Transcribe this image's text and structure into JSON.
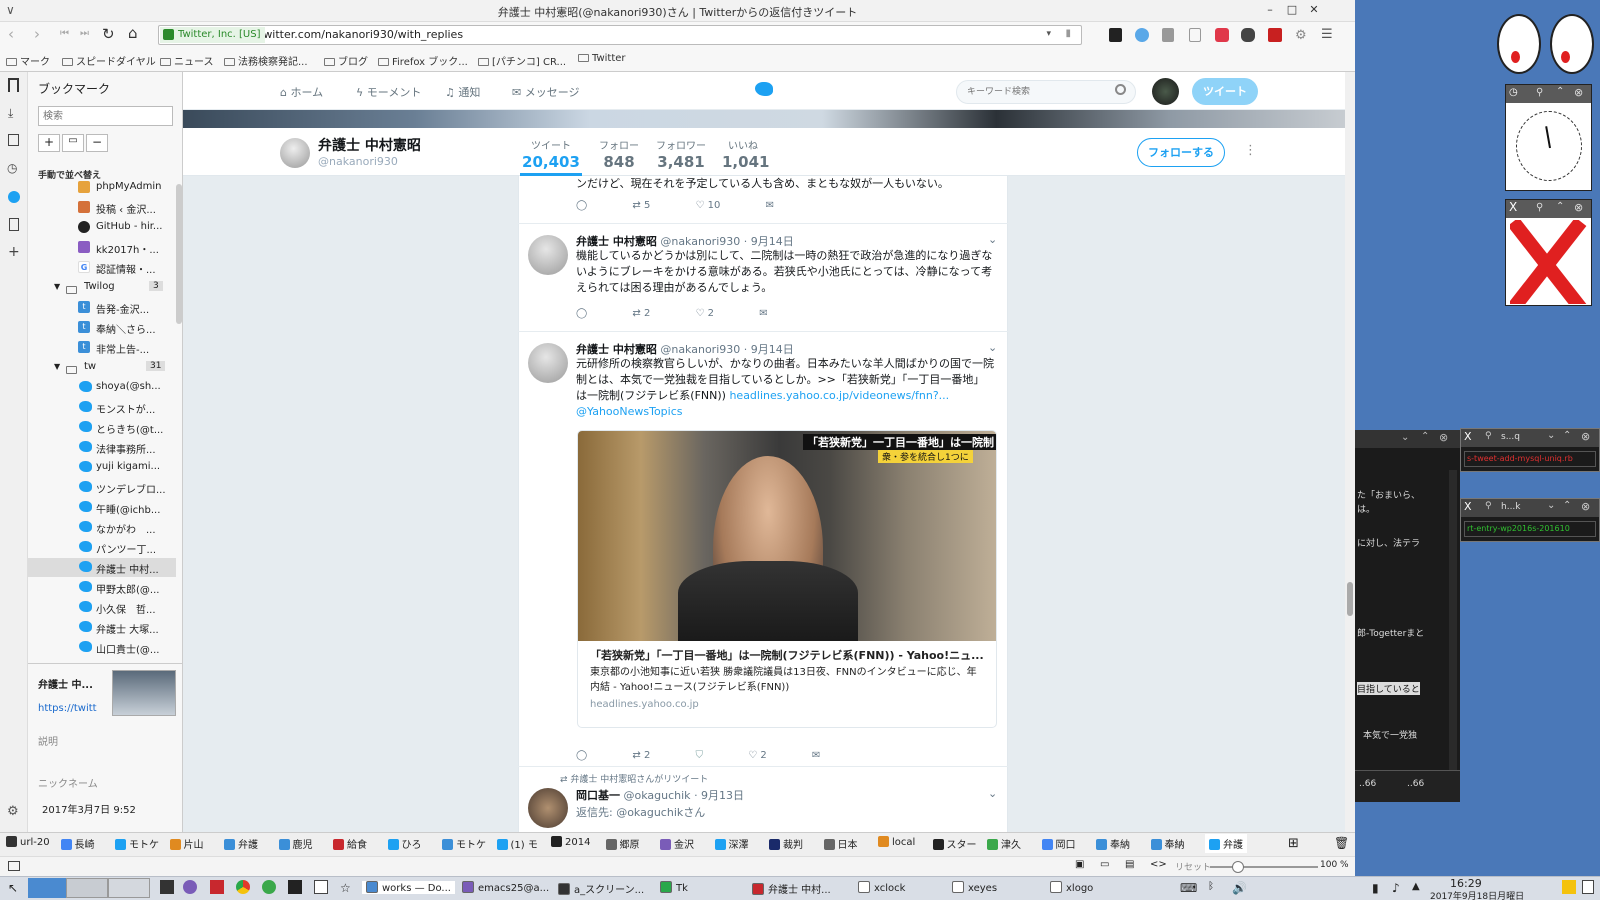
{
  "browser": {
    "window_title": "弁護士 中村憲昭(@nakanori930)さん | Twitterからの返信付きツイート",
    "secure_label": "Twitter, Inc. [US]",
    "url": "twitter.com/nakanori930/with_replies",
    "bookmarks_bar": [
      "マーク",
      "スピードダイヤル",
      "ニュース",
      "法務検察発記...",
      "ブログ",
      "Firefox ブック...",
      "[パチンコ] CR...",
      "Twitter"
    ]
  },
  "sidebar": {
    "title": "ブックマーク",
    "search_placeholder": "検索",
    "sort_label": "手動で並べ替え",
    "items": [
      {
        "label": "phpMyAdmin"
      },
      {
        "label": "投稿 ‹ 金沢..."
      },
      {
        "label": "GitHub - hir..."
      },
      {
        "label": "kk2017h・..."
      },
      {
        "label": "認証情報・..."
      }
    ],
    "folder_twilog": {
      "label": "Twilog",
      "count": "3"
    },
    "twilog_items": [
      "告発-金沢...",
      "奉納＼さら...",
      "非常上告-..."
    ],
    "folder_tw": {
      "label": "tw",
      "count": "31"
    },
    "tw_items": [
      "shoya(@sh...",
      "モンストが...",
      "とらきち(@t...",
      "法律事務所...",
      "yuji kigami...",
      "ツンデレブロ...",
      "午睡(@ichb...",
      "なかがわ　...",
      "パンツー丁...",
      "弁護士 中村...",
      "甲野太郎(@...",
      "小久保　哲...",
      "弁護士 大塚...",
      "山口貴士(@..."
    ],
    "preview": {
      "name": "弁護士 中...",
      "url": "https://twitt",
      "desc_label": "説明",
      "nick_label": "ニックネーム",
      "date": "2017年3月7日 9:52"
    }
  },
  "twitter": {
    "nav": [
      "ホーム",
      "モーメント",
      "通知",
      "メッセージ"
    ],
    "search_placeholder": "キーワード検索",
    "tweet_button": "ツイート",
    "profile": {
      "name": "弁護士 中村憲昭",
      "handle": "@nakanori930",
      "follow_button": "フォローする",
      "stats": [
        {
          "label": "ツイート",
          "value": "20,403"
        },
        {
          "label": "フォロー",
          "value": "848"
        },
        {
          "label": "フォロワー",
          "value": "3,481"
        },
        {
          "label": "いいね",
          "value": "1,041"
        }
      ]
    },
    "tweets": [
      {
        "text": "ンだけど、現在それを予定している人も含め、まともな奴が一人もいない。",
        "retweets": "5",
        "likes": "10"
      },
      {
        "name": "弁護士 中村憲昭",
        "handle": "@nakanori930",
        "date": "· 9月14日",
        "text": "機能しているかどうかは別にして、二院制は一時の熱狂で政治が急進的になり過ぎないようにブレーキをかける意味がある。若狭氏や小池氏にとっては、冷静になって考えられては困る理由があるんでしょう。",
        "retweets": "2",
        "likes": "2"
      },
      {
        "name": "弁護士 中村憲昭",
        "handle": "@nakanori930",
        "date": "· 9月14日",
        "text": "元研修所の検察教官らしいが、かなりの曲者。日本みたいな羊人間ばかりの国で一院制とは、本気で一党独裁を目指しているとしか。>>「若狭新党」「一丁目一番地」は一院制(フジテレビ系(FNN))",
        "link": "headlines.yahoo.co.jp/videonews/fnn?...",
        "mention": "@YahooNewsTopics",
        "card": {
          "caption_top": "「若狭新党」一丁目一番地」は一院制",
          "caption_sub": "衆・参を統合し1つに",
          "title": "「若狭新党」「一丁目一番地」は一院制(フジテレビ系(FNN)) - Yahoo!ニュ...",
          "desc": "東京都の小池知事に近い若狭 勝衆議院議員は13日夜、FNNのインタビューに応じ、年内結 - Yahoo!ニュース(フジテレビ系(FNN))",
          "domain": "headlines.yahoo.co.jp"
        },
        "retweets": "2",
        "likes": "2"
      },
      {
        "retweet_note": "弁護士 中村憲昭さんがリツイート",
        "name": "岡口基一",
        "handle": "@okaguchik",
        "date": "· 9月13日",
        "reply_to": "返信先: @okaguchikさん"
      }
    ]
  },
  "tabs": [
    "url-20",
    "長崎",
    "モトケ",
    "片山",
    "弁護",
    "鹿児",
    "給食",
    "ひろ",
    "モトケ",
    "(1) モ",
    "2014",
    "郷原",
    "金沢",
    "深澤",
    "裁判",
    "日本",
    "local",
    "スター",
    "津久",
    "岡口",
    "奉納",
    "奉納",
    "弁護"
  ],
  "status": {
    "reset": "リセット",
    "zoom": "100 %"
  },
  "panel": {
    "apps": [
      "works — Do...",
      "emacs25@a...",
      "a_スクリーン...",
      "Tk",
      "弁護士 中村...",
      "xclock",
      "xeyes",
      "xlogo"
    ],
    "time": "16:29",
    "date": "2017年9月18日月曜日"
  },
  "desktop": {
    "terminal_lines": [
      "た「おまいら、",
      "は。",
      "に対し、法テラ",
      "郎-Togetterまと",
      "目指していると",
      "本気で一党独"
    ],
    "terminal_tabs": [
      "..66",
      "..66"
    ],
    "xwin1": {
      "title": "s...q",
      "content": "s-tweet-add-mysql-uniq.rb"
    },
    "xwin2": {
      "title": "h...k",
      "content": "rt-entry-wp2016s-201610"
    }
  }
}
